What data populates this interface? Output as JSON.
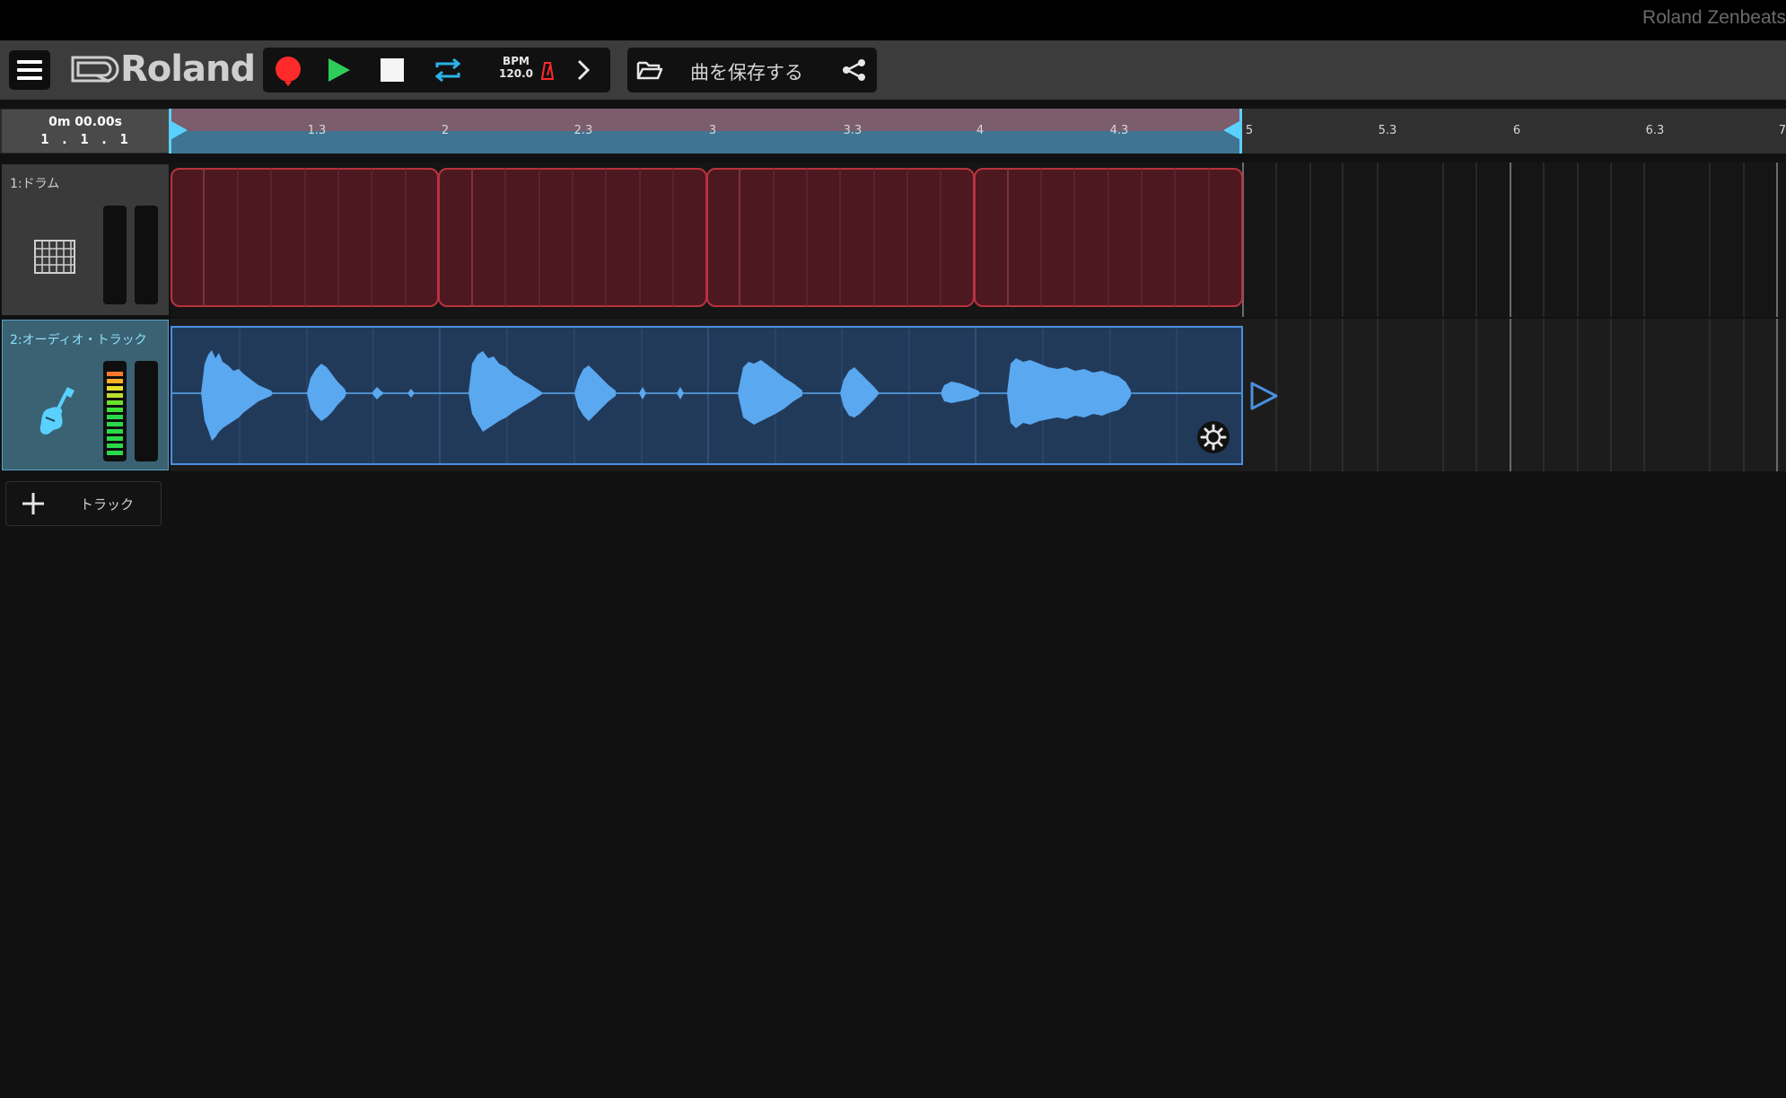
{
  "app": {
    "title": "Roland Zenbeats"
  },
  "toolbar": {
    "logo_text": "Roland",
    "bpm_label": "BPM",
    "bpm_value": "120.0",
    "save_label": "曲を保存する"
  },
  "ruler": {
    "time": "0m 00.00s",
    "position": "1 . 1 . 1",
    "marks": [
      "1.3",
      "2",
      "2.3",
      "3",
      "3.3",
      "4",
      "4.3",
      "5",
      "5.3",
      "6",
      "6.3",
      "7"
    ]
  },
  "tracks": [
    {
      "name": "1:ドラム",
      "type": "drum",
      "clip_count": 4,
      "clip_color": "#4d1820",
      "clip_border": "#b8323f"
    },
    {
      "name": "2:オーディオ・トラック",
      "type": "audio",
      "clip_color": "#223a5a",
      "clip_border": "#4a90e0",
      "selected": true
    }
  ],
  "add_track": {
    "label": "トラック"
  },
  "colors": {
    "record": "#ff2a2a",
    "play": "#2ecc5a",
    "loop": "#2ab4e8",
    "accent": "#5ab8ff",
    "waveform": "#5aa8f0"
  }
}
